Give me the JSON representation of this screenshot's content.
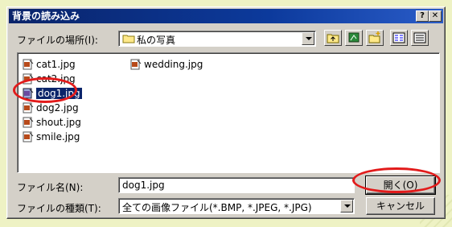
{
  "window": {
    "title": "背景の読み込み",
    "help_label": "?",
    "close_label": "✕"
  },
  "location": {
    "label": "ファイルの場所(I):",
    "value": "私の写真"
  },
  "toolbar": {
    "up_icon": "up-folder-icon",
    "newfolder_icon": "desktop-icon",
    "new_icon": "new-folder-icon",
    "list_view_icon": "list-view-icon",
    "details_view_icon": "details-view-icon"
  },
  "files": [
    {
      "name": "cat1.jpg"
    },
    {
      "name": "cat2.jpg"
    },
    {
      "name": "dog1.jpg",
      "selected": true
    },
    {
      "name": "dog2.jpg"
    },
    {
      "name": "shout.jpg"
    },
    {
      "name": "smile.jpg"
    },
    {
      "name": "wedding.jpg"
    }
  ],
  "filename": {
    "label": "ファイル名(N):",
    "value": "dog1.jpg"
  },
  "filetype": {
    "label": "ファイルの種類(T):",
    "value": "全ての画像ファイル(*.BMP, *.JPEG, *.JPG)"
  },
  "buttons": {
    "open": "開く(O)",
    "cancel": "キャンセル"
  },
  "annotation_color": "#e21b1b"
}
